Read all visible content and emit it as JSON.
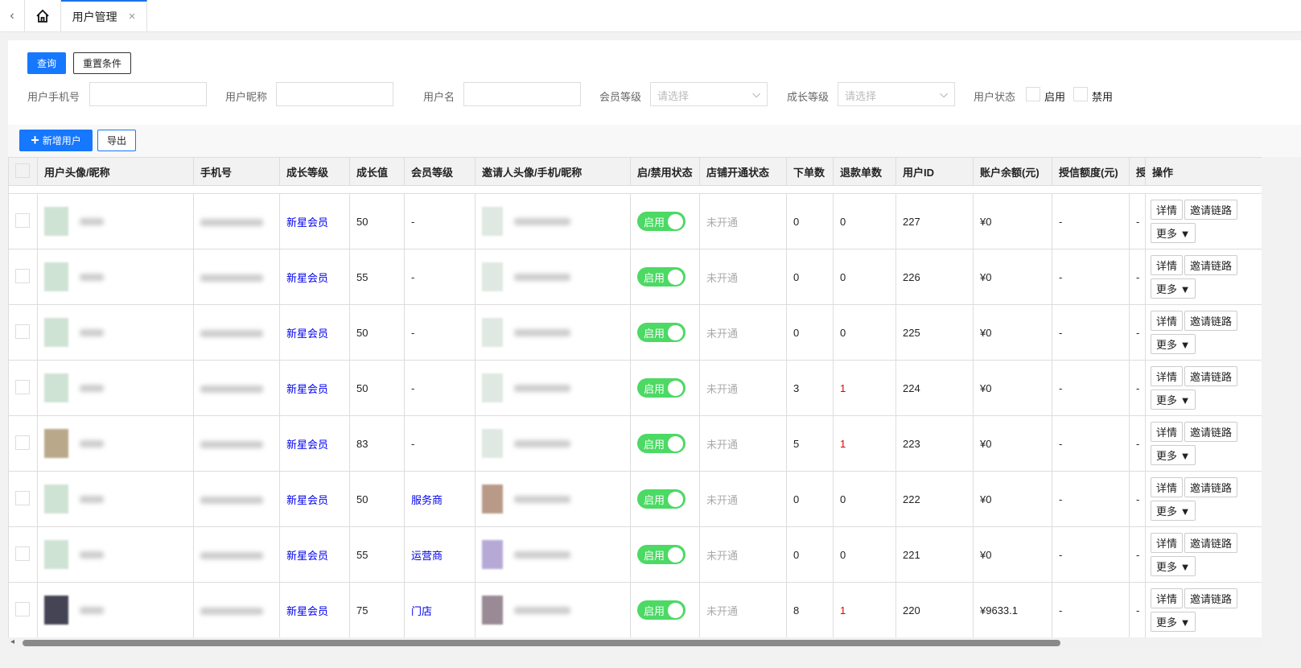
{
  "tabs": {
    "back_icon": "chevron-left",
    "home_icon": "home",
    "active": "用户管理",
    "close_icon": "×"
  },
  "filters": {
    "search": "查询",
    "reset": "重置条件",
    "phone_label": "用户手机号",
    "nickname_label": "用户昵称",
    "username_label": "用户名",
    "member_label": "会员等级",
    "member_placeholder": "请选择",
    "growth_label": "成长等级",
    "growth_placeholder": "请选择",
    "status_label": "用户状态",
    "enabled": "启用",
    "disabled": "禁用"
  },
  "toolbar": {
    "add": "新增用户",
    "export": "导出"
  },
  "columns": [
    "用户头像/昵称",
    "手机号",
    "成长等级",
    "成长值",
    "会员等级",
    "邀请人头像/手机/昵称",
    "启/禁用状态",
    "店铺开通状态",
    "下单数",
    "退款单数",
    "用户ID",
    "账户余额(元)",
    "授信额度(元)",
    "授",
    "操作"
  ],
  "actions": {
    "detail": "详情",
    "invite": "邀请链路",
    "more": "更多 ▼",
    "toggle": "启用"
  },
  "rows": [
    {
      "nick": "2273",
      "growth_level": "新星会员",
      "growth": "50",
      "member": "-",
      "shop": "未开通",
      "orders": "0",
      "refunds": "0",
      "uid": "227",
      "balance": "¥0",
      "credit": "-",
      "extra": "-"
    },
    {
      "nick": "2272",
      "growth_level": "新星会员",
      "growth": "55",
      "member": "-",
      "shop": "未开通",
      "orders": "0",
      "refunds": "0",
      "uid": "226",
      "balance": "¥0",
      "credit": "-",
      "extra": "-"
    },
    {
      "nick": "2271",
      "growth_level": "新星会员",
      "growth": "50",
      "member": "-",
      "shop": "未开通",
      "orders": "0",
      "refunds": "0",
      "uid": "225",
      "balance": "¥0",
      "credit": "-",
      "extra": "-"
    },
    {
      "nick": "",
      "growth_level": "新星会员",
      "growth": "50",
      "member": "-",
      "shop": "未开通",
      "orders": "3",
      "refunds": "1",
      "uid": "224",
      "balance": "¥0",
      "credit": "-",
      "extra": "-"
    },
    {
      "nick": "",
      "growth_level": "新星会员",
      "growth": "83",
      "member": "-",
      "shop": "未开通",
      "orders": "5",
      "refunds": "1",
      "uid": "223",
      "balance": "¥0",
      "credit": "-",
      "extra": "-"
    },
    {
      "nick": "",
      "growth_level": "新星会员",
      "growth": "50",
      "member": "服务商",
      "shop": "未开通",
      "orders": "0",
      "refunds": "0",
      "uid": "222",
      "balance": "¥0",
      "credit": "-",
      "extra": "-"
    },
    {
      "nick": "",
      "growth_level": "新星会员",
      "growth": "55",
      "member": "运营商",
      "shop": "未开通",
      "orders": "0",
      "refunds": "0",
      "uid": "221",
      "balance": "¥0",
      "credit": "-",
      "extra": "-"
    },
    {
      "nick": "",
      "growth_level": "新星会员",
      "growth": "75",
      "member": "门店",
      "shop": "未开通",
      "orders": "8",
      "refunds": "1",
      "uid": "220",
      "balance": "¥9633.1",
      "credit": "-",
      "extra": "-"
    }
  ],
  "colors": {
    "primary": "#1677ff",
    "toggle_on": "#4cd964",
    "link": "#0000ee",
    "refund_alert": "#dd0000"
  }
}
